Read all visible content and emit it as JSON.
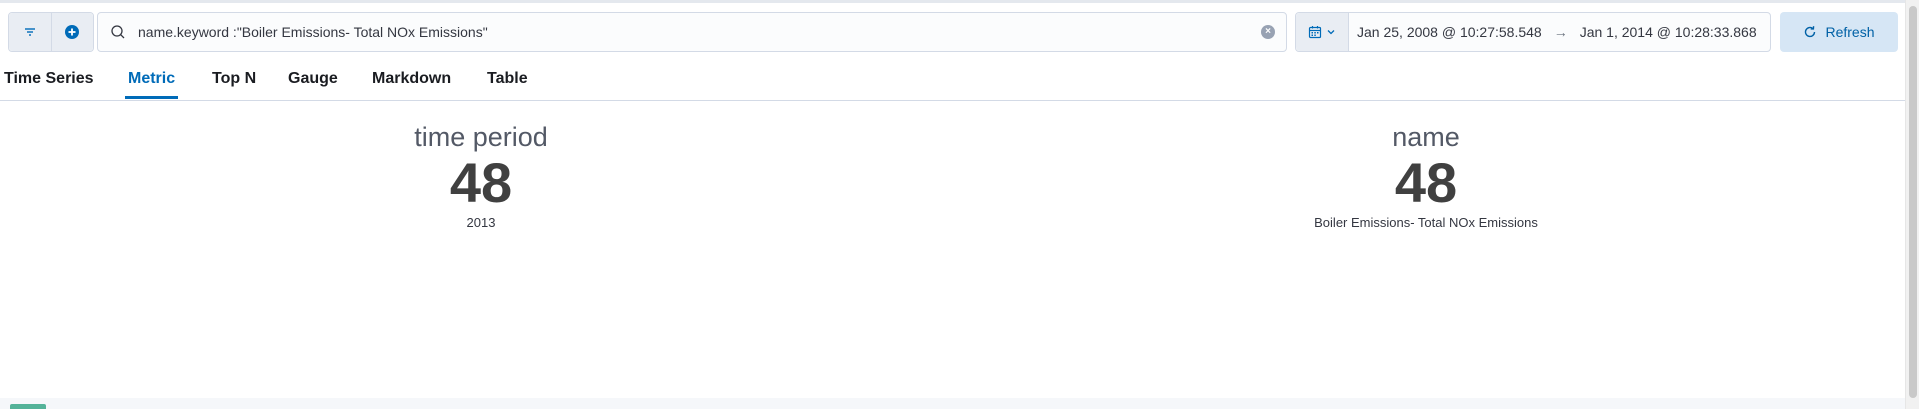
{
  "query": {
    "text": "name.keyword :\"Boiler Emissions- Total NOx Emissions\""
  },
  "date_range": {
    "start": "Jan 25, 2008 @ 10:27:58.548",
    "end": "Jan 1, 2014 @ 10:28:33.868"
  },
  "refresh_label": "Refresh",
  "tabs": [
    {
      "label": "Time Series"
    },
    {
      "label": "Metric"
    },
    {
      "label": "Top N"
    },
    {
      "label": "Gauge"
    },
    {
      "label": "Markdown"
    },
    {
      "label": "Table"
    }
  ],
  "active_tab": "Metric",
  "metrics": [
    {
      "title": "time period",
      "value": "48",
      "subtitle": "2013"
    },
    {
      "title": "name",
      "value": "48",
      "subtitle": "Boiler Emissions- Total NOx Emissions"
    }
  ],
  "colors": {
    "accent": "#006bb8",
    "refresh_bg": "#d6e6f5",
    "metric_value": "#404040"
  }
}
